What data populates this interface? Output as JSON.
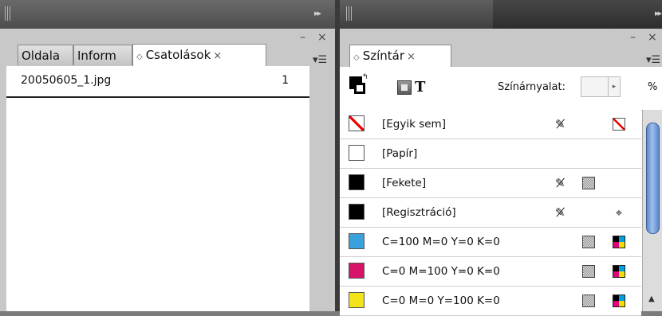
{
  "left_panel": {
    "tabs": [
      {
        "label": "Oldala"
      },
      {
        "label": "Inform"
      },
      {
        "label": "Csatolások",
        "active": true,
        "close": "×"
      }
    ],
    "links": [
      {
        "name": "20050605_1.jpg",
        "page": "1"
      }
    ]
  },
  "right_panel": {
    "tab": {
      "label": "Színtár",
      "close": "×"
    },
    "tint_label": "Színárnyalat:",
    "tint_value": "",
    "percent": "%",
    "text_format_label": "T",
    "swatches": [
      {
        "name": "[Egyik sem]",
        "color": "none"
      },
      {
        "name": "[Papír]",
        "color": "#ffffff"
      },
      {
        "name": "[Fekete]",
        "color": "#000000"
      },
      {
        "name": "[Regisztráció]",
        "color": "#000000"
      },
      {
        "name": "C=100 M=0 Y=0 K=0",
        "color": "#3aa1dd"
      },
      {
        "name": "C=0 M=100 Y=0 K=0",
        "color": "#d8146a"
      },
      {
        "name": "C=0 M=0 Y=100 K=0",
        "color": "#f3e31a"
      }
    ]
  },
  "window_controls": {
    "minimize": "–",
    "close": "×",
    "menu": "▾☰",
    "collapse": "▸▸"
  }
}
